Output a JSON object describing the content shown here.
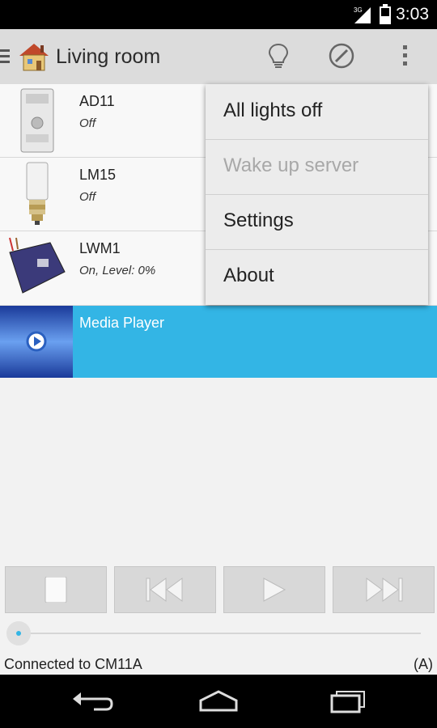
{
  "status_bar": {
    "time": "3:03",
    "network": "3G",
    "icons": [
      "signal-icon",
      "battery-icon"
    ]
  },
  "action_bar": {
    "title": "Living room",
    "icons": [
      "drawer-icon",
      "home-icon",
      "lightbulb-icon",
      "disable-icon",
      "overflow-menu-icon"
    ]
  },
  "devices": [
    {
      "name": "AD11",
      "status": "Off",
      "icon": "din-rail-module-icon"
    },
    {
      "name": "LM15",
      "status": "Off",
      "icon": "lamp-socket-icon"
    },
    {
      "name": "LWM1",
      "status": "On, Level: 0%",
      "icon": "wall-dimmer-module-icon"
    },
    {
      "name": "Media Player",
      "status": "",
      "icon": "media-player-icon",
      "selected": true
    }
  ],
  "overflow_menu": {
    "items": [
      {
        "label": "All lights off",
        "enabled": true
      },
      {
        "label": "Wake up server",
        "enabled": false
      },
      {
        "label": "Settings",
        "enabled": true
      },
      {
        "label": "About",
        "enabled": true
      }
    ]
  },
  "player": {
    "buttons": [
      "stop-icon",
      "previous-icon",
      "play-icon",
      "next-icon"
    ],
    "seek_position": 0
  },
  "footer": {
    "connection": "Connected to CM11A",
    "mode": "(A)"
  },
  "nav_bar": {
    "buttons": [
      "back-icon",
      "home-nav-icon",
      "recents-icon"
    ]
  },
  "colors": {
    "selected_row": "#33b5e5",
    "action_bar": "#dcdcdc",
    "status_bar": "#000000"
  }
}
